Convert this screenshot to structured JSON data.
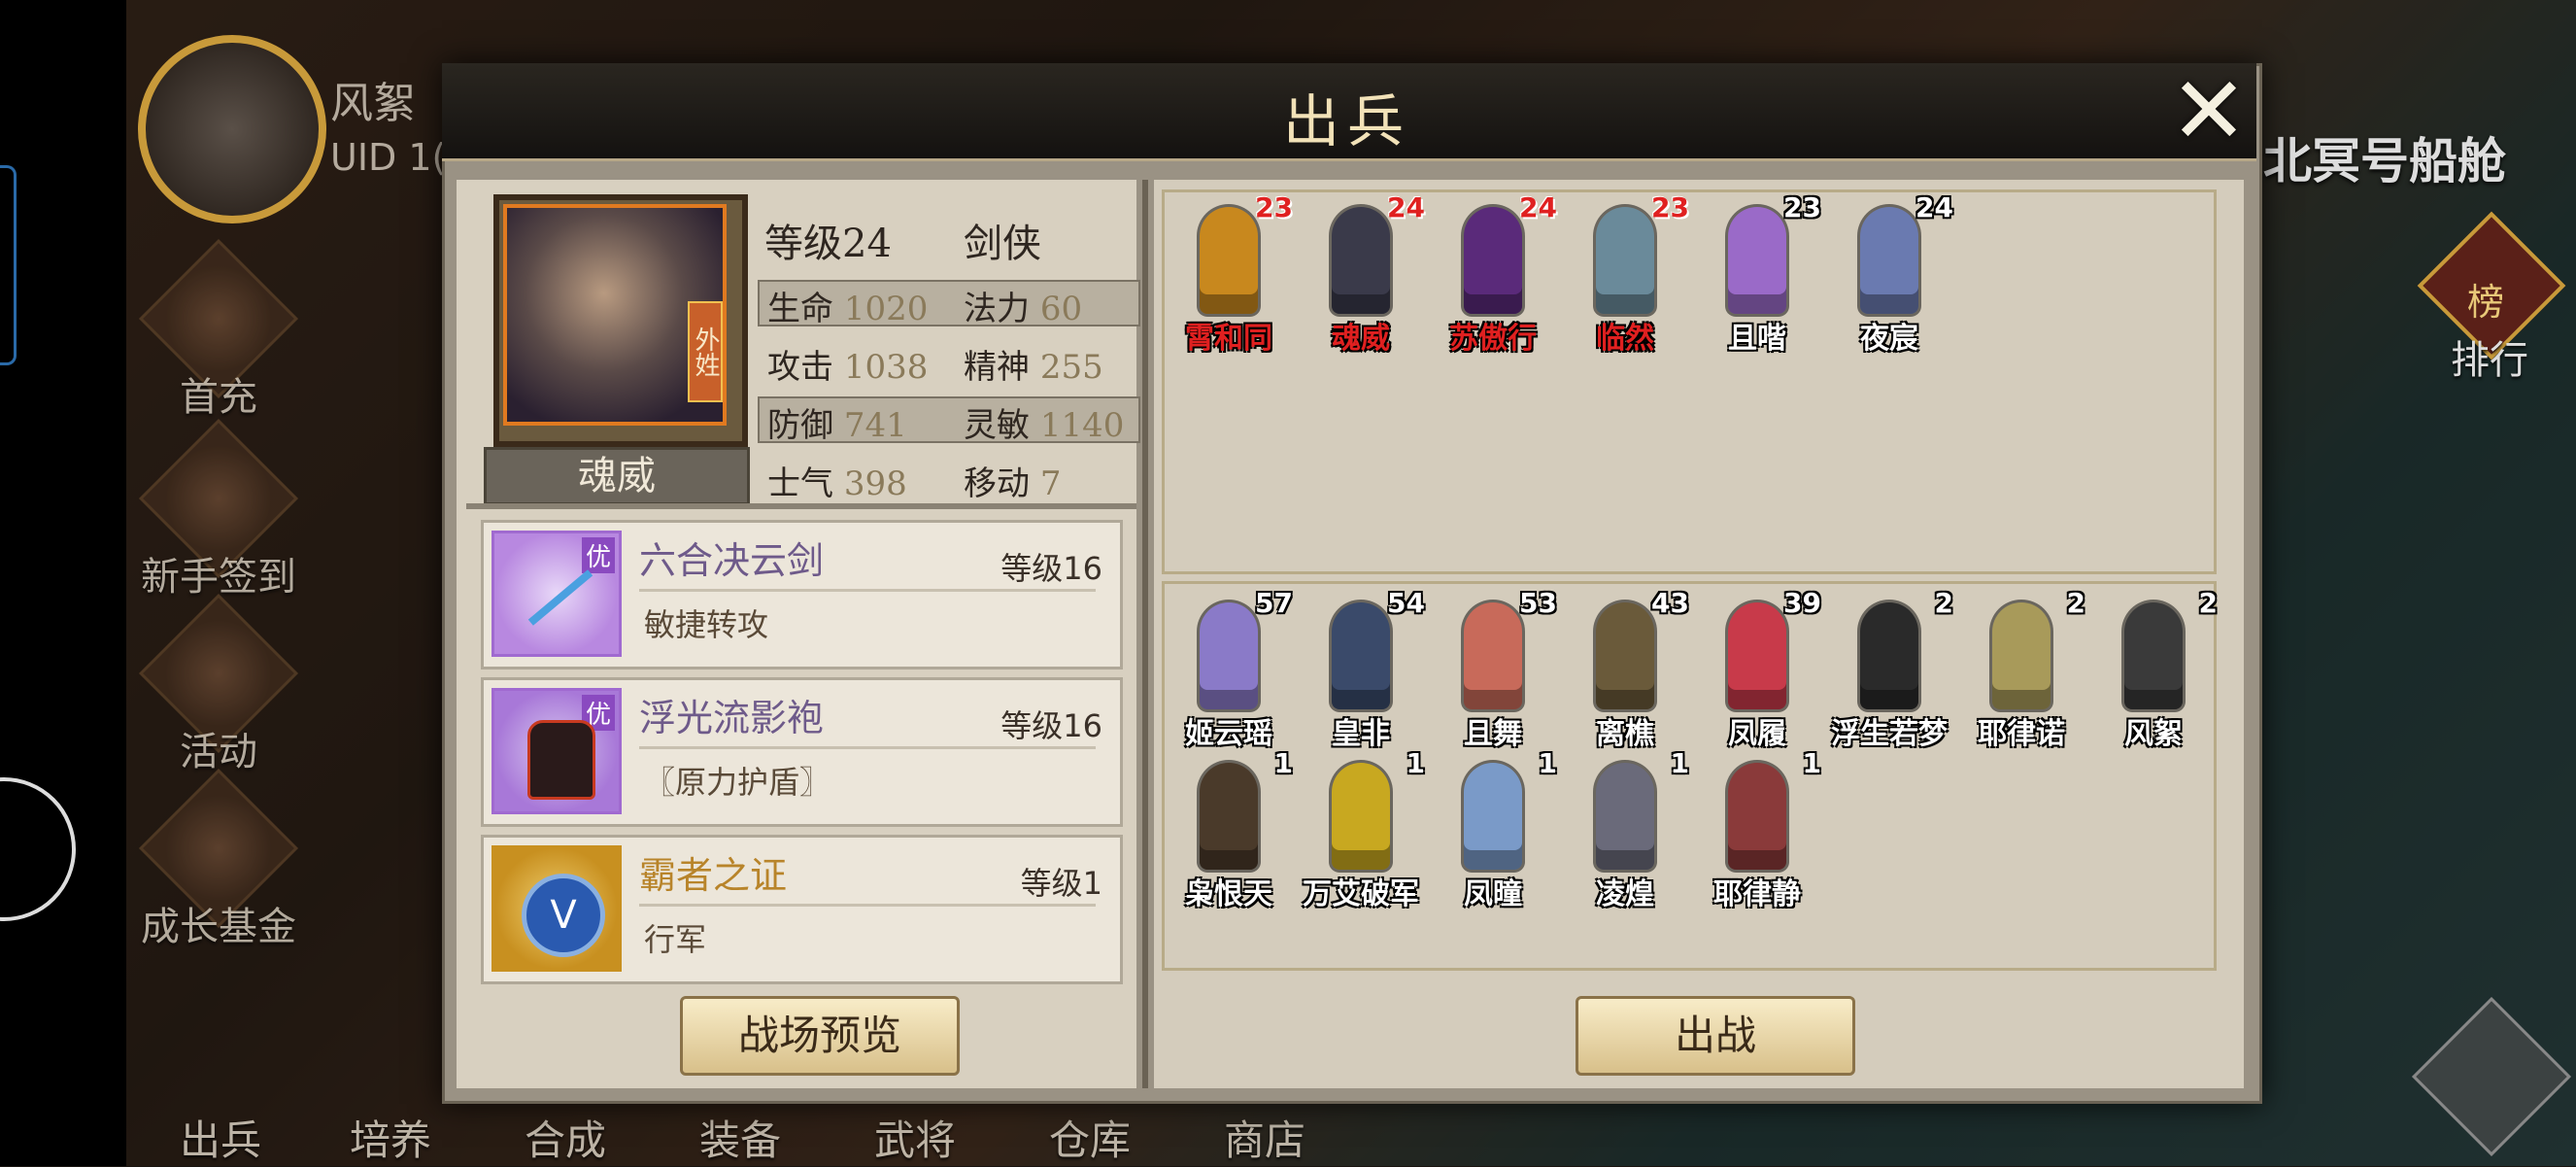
{
  "background": {
    "player_name": "风絮",
    "uid_text": "UID 1(",
    "location_title": "北冥号船舱",
    "rank_label": "排行",
    "rank_badge": "榜",
    "side_menu": [
      "首充",
      "新手签到",
      "活动",
      "成长基金"
    ],
    "bottom_menu": [
      "出兵",
      "培养",
      "合成",
      "装备",
      "武将",
      "仓库",
      "商店"
    ]
  },
  "dialog": {
    "title": "出兵",
    "hero": {
      "name": "魂威",
      "portrait_tag": "外姓",
      "level_text": "等级24",
      "class": "剑侠",
      "stats": [
        {
          "label": "生命",
          "value": "1020"
        },
        {
          "label": "法力",
          "value": "60"
        },
        {
          "label": "攻击",
          "value": "1038"
        },
        {
          "label": "精神",
          "value": "255"
        },
        {
          "label": "防御",
          "value": "741"
        },
        {
          "label": "灵敏",
          "value": "1140"
        },
        {
          "label": "士气",
          "value": "398"
        },
        {
          "label": "移动",
          "value": "7"
        }
      ]
    },
    "equipment": [
      {
        "name": "六合决云剑",
        "level": "等级16",
        "desc": "敏捷转攻",
        "badge": "优",
        "icon": "sword-icon"
      },
      {
        "name": "浮光流影袍",
        "level": "等级16",
        "desc": "〖原力护盾〗",
        "badge": "优",
        "icon": "armor-icon"
      },
      {
        "name": "霸者之证",
        "level": "等级1",
        "desc": "行军",
        "badge": "",
        "icon": "medal-icon"
      }
    ],
    "preview_button": "战场预览",
    "deploy_button": "出战",
    "deployed_units": [
      {
        "name": "霄和同",
        "level": "23",
        "red": true,
        "color": "#c8881e"
      },
      {
        "name": "魂威",
        "level": "24",
        "red": true,
        "color": "#3a3a4a"
      },
      {
        "name": "苏傲行",
        "level": "24",
        "red": true,
        "color": "#5a2a7a"
      },
      {
        "name": "临然",
        "level": "23",
        "red": true,
        "color": "#6a8a9a"
      },
      {
        "name": "且喈",
        "level": "23",
        "red": false,
        "color": "#9a6ac8"
      },
      {
        "name": "夜宸",
        "level": "24",
        "red": false,
        "color": "#6a7ab0"
      }
    ],
    "available_units": [
      {
        "name": "姬云瑶",
        "level": "57",
        "color": "#8a7ac8"
      },
      {
        "name": "皇非",
        "level": "54",
        "color": "#3a4a6a"
      },
      {
        "name": "且舞",
        "level": "53",
        "color": "#c86a5a"
      },
      {
        "name": "离樵",
        "level": "43",
        "color": "#6a5a3a"
      },
      {
        "name": "凤履",
        "level": "39",
        "color": "#c83a4a"
      },
      {
        "name": "浮生若梦",
        "level": "2",
        "color": "#2a2a2a"
      },
      {
        "name": "耶律诺",
        "level": "2",
        "color": "#a89a5a"
      },
      {
        "name": "风絮",
        "level": "2",
        "color": "#3a3a3a"
      },
      {
        "name": "枭恨天",
        "level": "1",
        "color": "#4a3a2a"
      },
      {
        "name": "万艾破军",
        "level": "1",
        "color": "#c8a820"
      },
      {
        "name": "凤曈",
        "level": "1",
        "color": "#7a9ac8"
      },
      {
        "name": "凌煌",
        "level": "1",
        "color": "#6a6a7a"
      },
      {
        "name": "耶律静",
        "level": "1",
        "color": "#8a3a3a"
      }
    ]
  }
}
